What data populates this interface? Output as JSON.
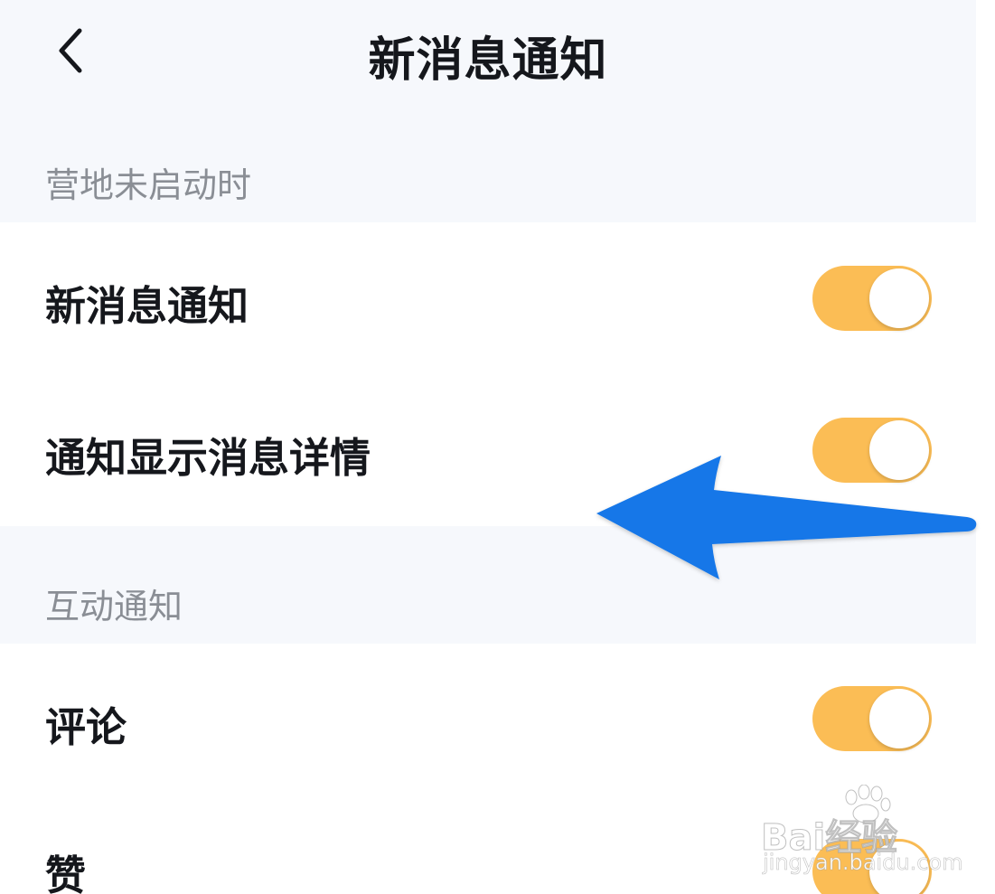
{
  "header": {
    "title": "新消息通知",
    "back_icon": "chevron-left-icon"
  },
  "sections": [
    {
      "title": "营地未启动时",
      "items": [
        {
          "label": "新消息通知",
          "enabled": true
        },
        {
          "label": "通知显示消息详情",
          "enabled": true
        }
      ]
    },
    {
      "title": "互动通知",
      "items": [
        {
          "label": "评论",
          "enabled": true
        },
        {
          "label": "赞",
          "enabled": true
        }
      ]
    }
  ],
  "colors": {
    "toggle_on": "#fbbd55",
    "header_bg": "#f6f8fc",
    "arrow": "#1677e8"
  },
  "annotation": {
    "icon": "blue-arrow-left-icon"
  },
  "watermark": {
    "brand": "Bai经验",
    "url": "jingyan.baidu.com"
  }
}
